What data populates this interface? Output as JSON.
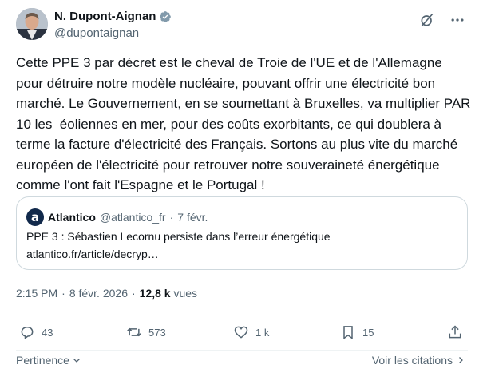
{
  "author": {
    "name": "N. Dupont-Aignan",
    "handle": "@dupontaignan",
    "verified_color": "#829aab"
  },
  "tweet": {
    "text": "Cette PPE 3 par décret est le cheval de Troie de l'UE et de l'Allemagne pour détruire notre modèle nucléaire, pouvant offrir une électricité bon marché. Le Gouvernement, en se soumettant à Bruxelles, va multiplier PAR 10 les  éoliennes en mer, pour des coûts exorbitants, ce qui doublera à terme la facture d'électricité des Français. Sortons au plus vite du marché européen de l'électricité pour retrouver notre souveraineté énergétique comme l'ont fait l'Espagne et le Portugal !"
  },
  "quote": {
    "logo_letter": "a",
    "name": "Atlantico",
    "handle": "@atlantico_fr",
    "separator": "·",
    "date": "7 févr.",
    "headline": "PPE 3 : Sébastien Lecornu persiste dans l’erreur énergétique",
    "link": "atlantico.fr/article/decryp…"
  },
  "meta": {
    "time": "2:15 PM",
    "separator1": "·",
    "date": "8 févr. 2026",
    "separator2": "·",
    "views_count": "12,8 k",
    "views_label": "vues"
  },
  "actions": {
    "replies": "43",
    "reposts": "573",
    "likes": "1 k",
    "bookmarks": "15"
  },
  "footer": {
    "sort_label": "Pertinence",
    "quotes_label": "Voir les citations"
  },
  "colors": {
    "text": "#0f1419",
    "secondary": "#536471",
    "border": "#cfd9de"
  }
}
